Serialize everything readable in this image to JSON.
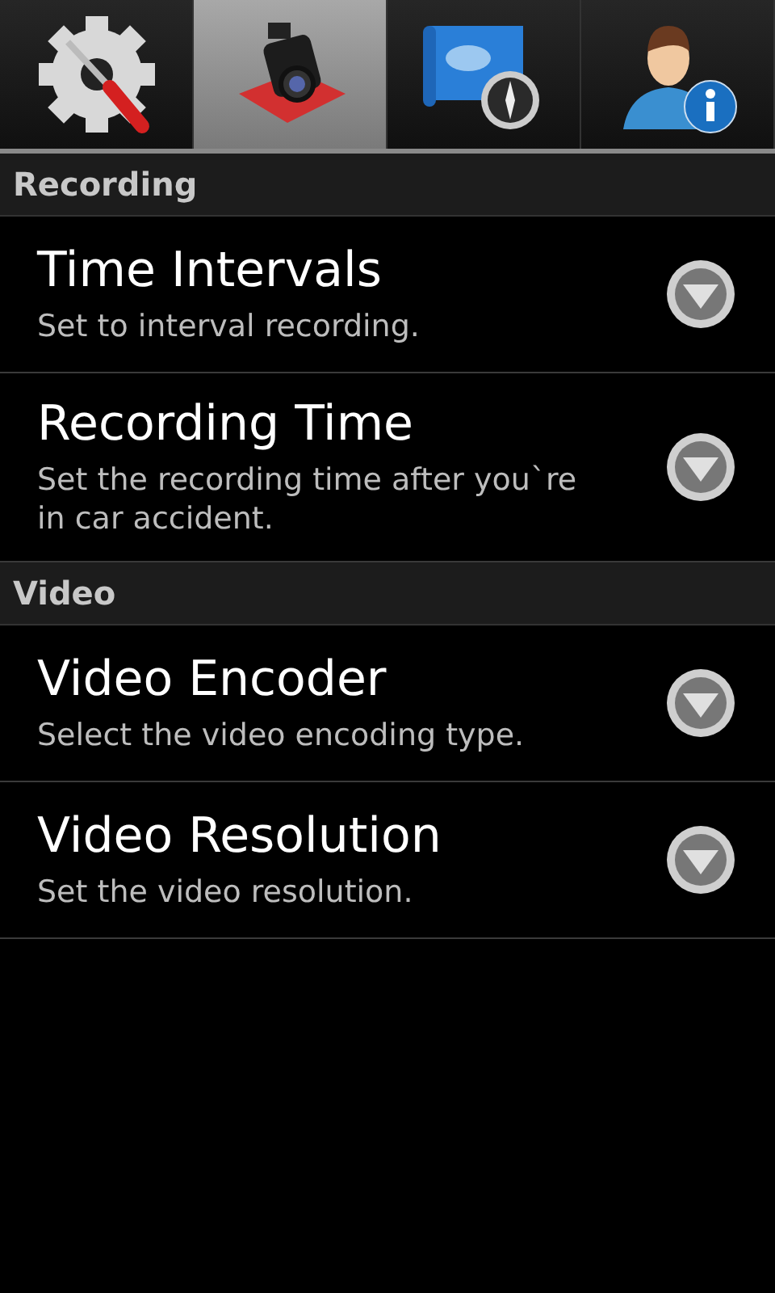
{
  "tabs": [
    {
      "kind": "settings",
      "selected": false
    },
    {
      "kind": "camera",
      "selected": true
    },
    {
      "kind": "map",
      "selected": false
    },
    {
      "kind": "user",
      "selected": false
    }
  ],
  "sections": [
    {
      "title": "Recording",
      "items": [
        {
          "title": "Time Intervals",
          "summary": "Set to interval recording."
        },
        {
          "title": "Recording Time",
          "summary": "Set the recording time after you`re in car accident."
        }
      ]
    },
    {
      "title": "Video",
      "items": [
        {
          "title": "Video Encoder",
          "summary": "Select the video encoding type."
        },
        {
          "title": "Video Resolution",
          "summary": "Set the video resolution."
        }
      ]
    }
  ]
}
